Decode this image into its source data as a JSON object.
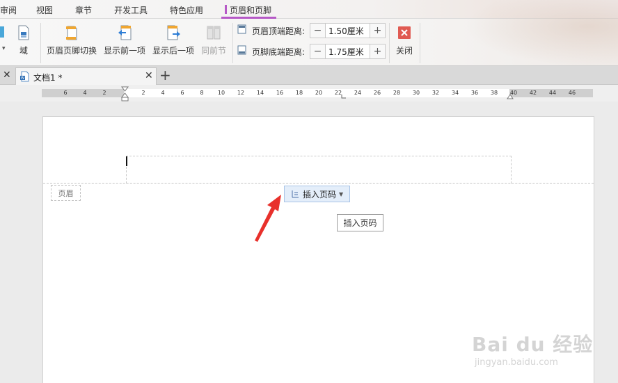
{
  "menubar": {
    "items": [
      "审阅",
      "视图",
      "章节",
      "开发工具",
      "特色应用",
      "页眉和页脚"
    ],
    "active": "页眉和页脚",
    "accent": "#b659c7"
  },
  "ribbon": {
    "partial_left": {
      "label": "域",
      "icon": "field-icon"
    },
    "buttons": [
      {
        "label": "页眉页脚切换",
        "icon": "header-footer-switch-icon",
        "enabled": true
      },
      {
        "label": "显示前一项",
        "icon": "show-previous-icon",
        "enabled": true
      },
      {
        "label": "显示后一项",
        "icon": "show-next-icon",
        "enabled": true
      },
      {
        "label": "同前节",
        "icon": "same-as-previous-icon",
        "enabled": false
      }
    ],
    "header_distance": {
      "label": "页眉顶端距离:",
      "value": "1.50厘米"
    },
    "footer_distance": {
      "label": "页脚底端距离:",
      "value": "1.75厘米"
    },
    "close": {
      "label": "关闭",
      "color": "#e05a52"
    }
  },
  "tabs": {
    "document_title": "文档1 *"
  },
  "ruler": {
    "left_numbers": [
      "6",
      "4",
      "2"
    ],
    "numbers": [
      "2",
      "4",
      "6",
      "8",
      "10",
      "12",
      "14",
      "16",
      "18",
      "20",
      "22",
      "24",
      "26",
      "28",
      "30",
      "32",
      "34",
      "36",
      "38",
      "40",
      "42",
      "44",
      "46"
    ]
  },
  "document": {
    "header_tag": "页眉",
    "insert_page_number": "插入页码",
    "tooltip": "插入页码"
  },
  "watermark": {
    "main": "Bai du 经验",
    "sub": "jingyan.baidu.com"
  }
}
